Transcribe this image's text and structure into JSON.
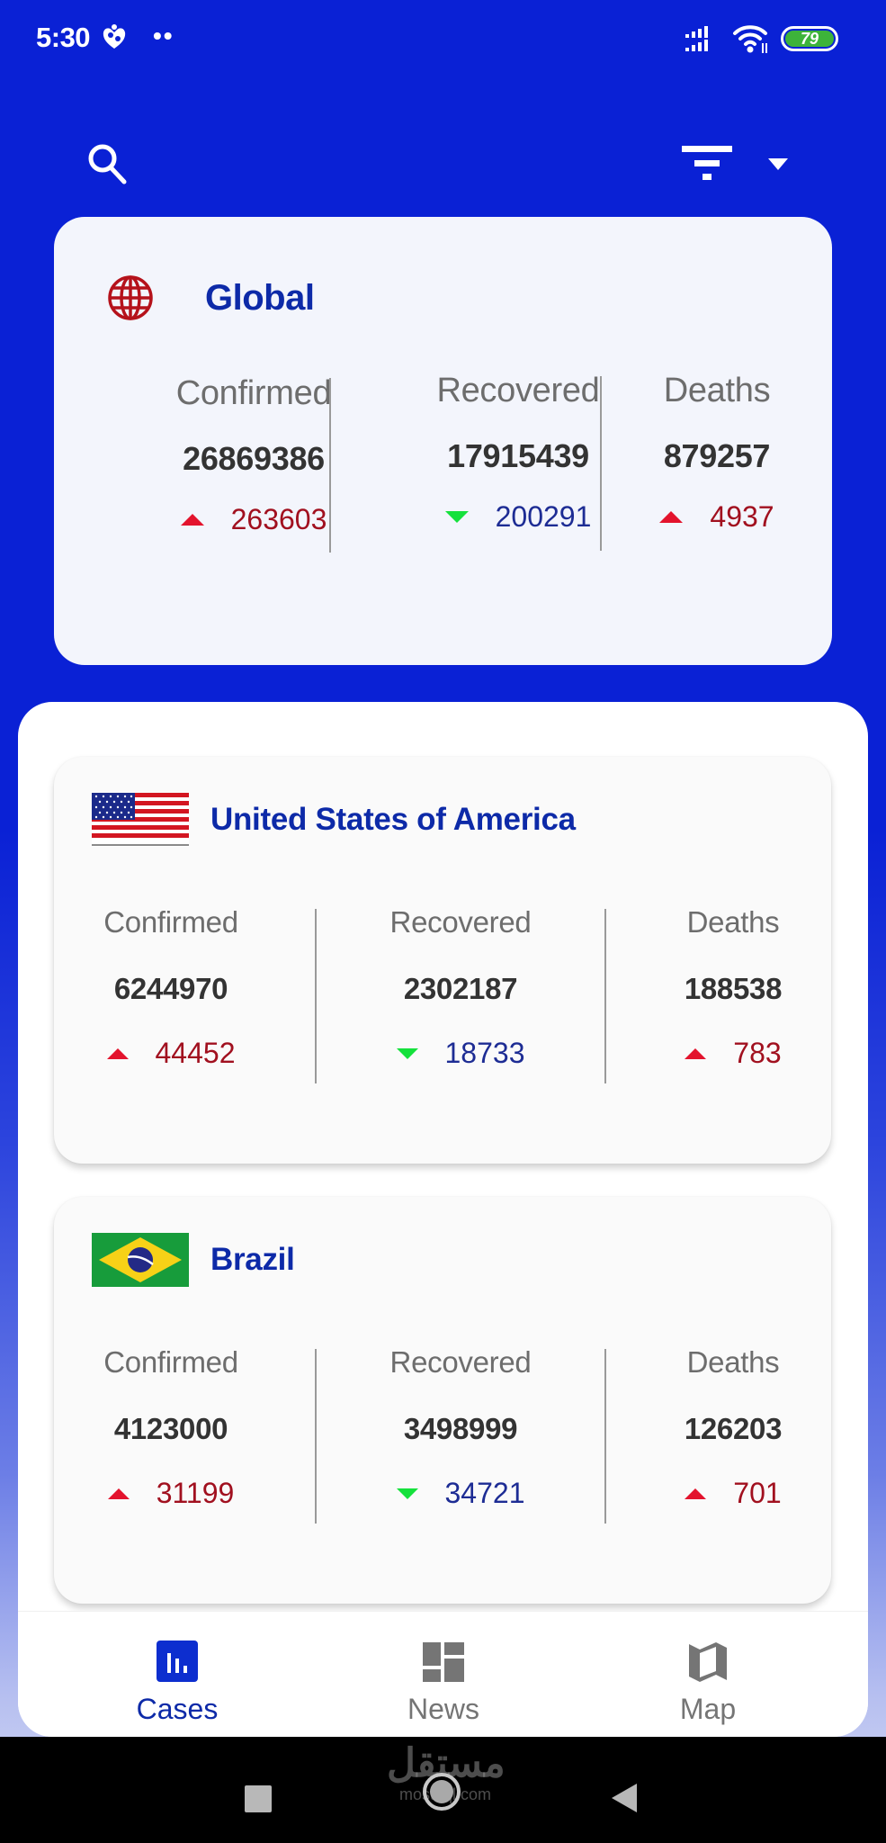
{
  "status_bar": {
    "time": "5:30",
    "dots": "••",
    "battery_level": "79",
    "icons": [
      "notification-app-icon",
      "signal-icon",
      "wifi-icon",
      "battery-icon"
    ]
  },
  "toolbar": {
    "search_icon": "search-icon",
    "filter_icon": "filter-icon",
    "dropdown_icon": "caret-down-icon"
  },
  "colors": {
    "primary": "#0a21d5",
    "title_blue": "#0d2aa8",
    "increase_red": "#e3132d",
    "increase_text": "#a1101f",
    "decrease_green": "#15e13c",
    "decrease_text": "#1d2c94"
  },
  "global": {
    "title": "Global",
    "icon": "globe-icon",
    "stats": [
      {
        "label": "Confirmed",
        "value": "26869386",
        "delta": "263603",
        "trend": "up"
      },
      {
        "label": "Recovered",
        "value": "17915439",
        "delta": "200291",
        "trend": "down"
      },
      {
        "label": "Deaths",
        "value": "879257",
        "delta": "4937",
        "trend": "up"
      }
    ]
  },
  "countries": [
    {
      "name": "United States of America",
      "flag": "usa-flag",
      "stats": [
        {
          "label": "Confirmed",
          "value": "6244970",
          "delta": "44452",
          "trend": "up"
        },
        {
          "label": "Recovered",
          "value": "2302187",
          "delta": "18733",
          "trend": "down"
        },
        {
          "label": "Deaths",
          "value": "188538",
          "delta": "783",
          "trend": "up"
        }
      ]
    },
    {
      "name": "Brazil",
      "flag": "brazil-flag",
      "stats": [
        {
          "label": "Confirmed",
          "value": "4123000",
          "delta": "31199",
          "trend": "up"
        },
        {
          "label": "Recovered",
          "value": "3498999",
          "delta": "34721",
          "trend": "down"
        },
        {
          "label": "Deaths",
          "value": "126203",
          "delta": "701",
          "trend": "up"
        }
      ]
    }
  ],
  "bottom_nav": {
    "active": "Cases",
    "items": [
      {
        "label": "Cases",
        "icon": "bar-chart-icon"
      },
      {
        "label": "News",
        "icon": "dashboard-icon"
      },
      {
        "label": "Map",
        "icon": "map-icon"
      }
    ]
  },
  "system_nav": {
    "buttons": [
      "recents-button",
      "home-button",
      "back-button"
    ],
    "watermark_ar": "مستقل",
    "watermark_en": "mostaql.com"
  }
}
